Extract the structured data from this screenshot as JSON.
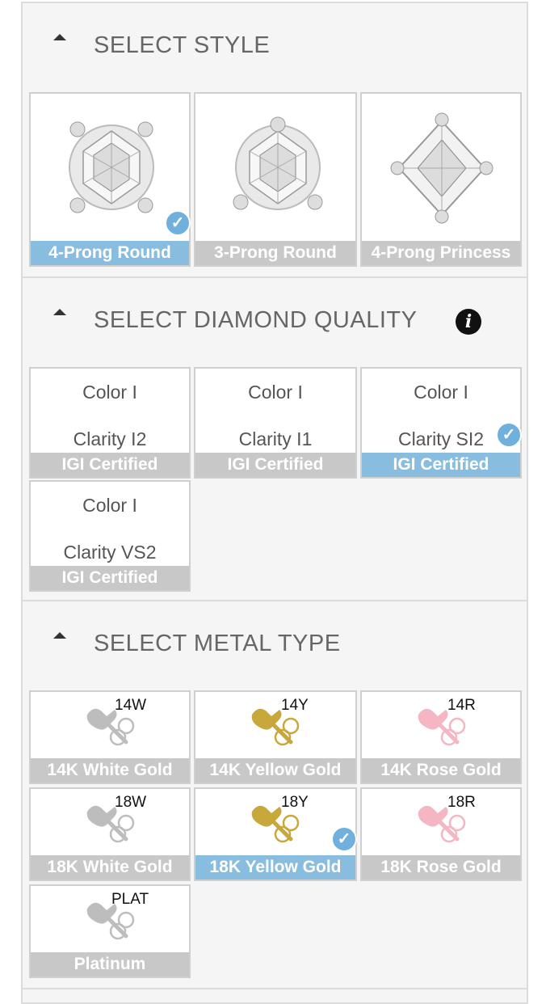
{
  "sections": {
    "style": {
      "title": "SELECT STYLE",
      "options": [
        {
          "label": "4-Prong Round",
          "selected": true
        },
        {
          "label": "3-Prong Round",
          "selected": false
        },
        {
          "label": "4-Prong Princess",
          "selected": false
        }
      ]
    },
    "quality": {
      "title": "SELECT DIAMOND QUALITY",
      "options": [
        {
          "color": "Color I",
          "clarity": "Clarity I2",
          "cert": "IGI Certified",
          "selected": false
        },
        {
          "color": "Color I",
          "clarity": "Clarity I1",
          "cert": "IGI Certified",
          "selected": false
        },
        {
          "color": "Color I",
          "clarity": "Clarity SI2",
          "cert": "IGI Certified",
          "selected": true
        },
        {
          "color": "Color I",
          "clarity": "Clarity VS2",
          "cert": "IGI Certified",
          "selected": false
        }
      ]
    },
    "metal": {
      "title": "SELECT METAL TYPE",
      "options": [
        {
          "code": "14W",
          "label": "14K White Gold",
          "tint": "#bdbdbd",
          "selected": false
        },
        {
          "code": "14Y",
          "label": "14K Yellow Gold",
          "tint": "#c8a83a",
          "selected": false
        },
        {
          "code": "14R",
          "label": "14K Rose Gold",
          "tint": "#f4b6c2",
          "selected": false
        },
        {
          "code": "18W",
          "label": "18K White Gold",
          "tint": "#bdbdbd",
          "selected": false
        },
        {
          "code": "18Y",
          "label": "18K Yellow Gold",
          "tint": "#c8a83a",
          "selected": true
        },
        {
          "code": "18R",
          "label": "18K Rose Gold",
          "tint": "#f4b6c2",
          "selected": false
        },
        {
          "code": "PLAT",
          "label": "Platinum",
          "tint": "#bdbdbd",
          "selected": false
        }
      ]
    }
  },
  "colors": {
    "selected_label_bg": "#89bde0",
    "label_bg": "#c8c8c8",
    "check_badge": "#6fb0dc"
  },
  "icons": {
    "collapse": "caret-up-icon",
    "info": "info-icon",
    "selected": "check-icon"
  },
  "glyphs": {
    "info": "i",
    "check": "✓"
  }
}
